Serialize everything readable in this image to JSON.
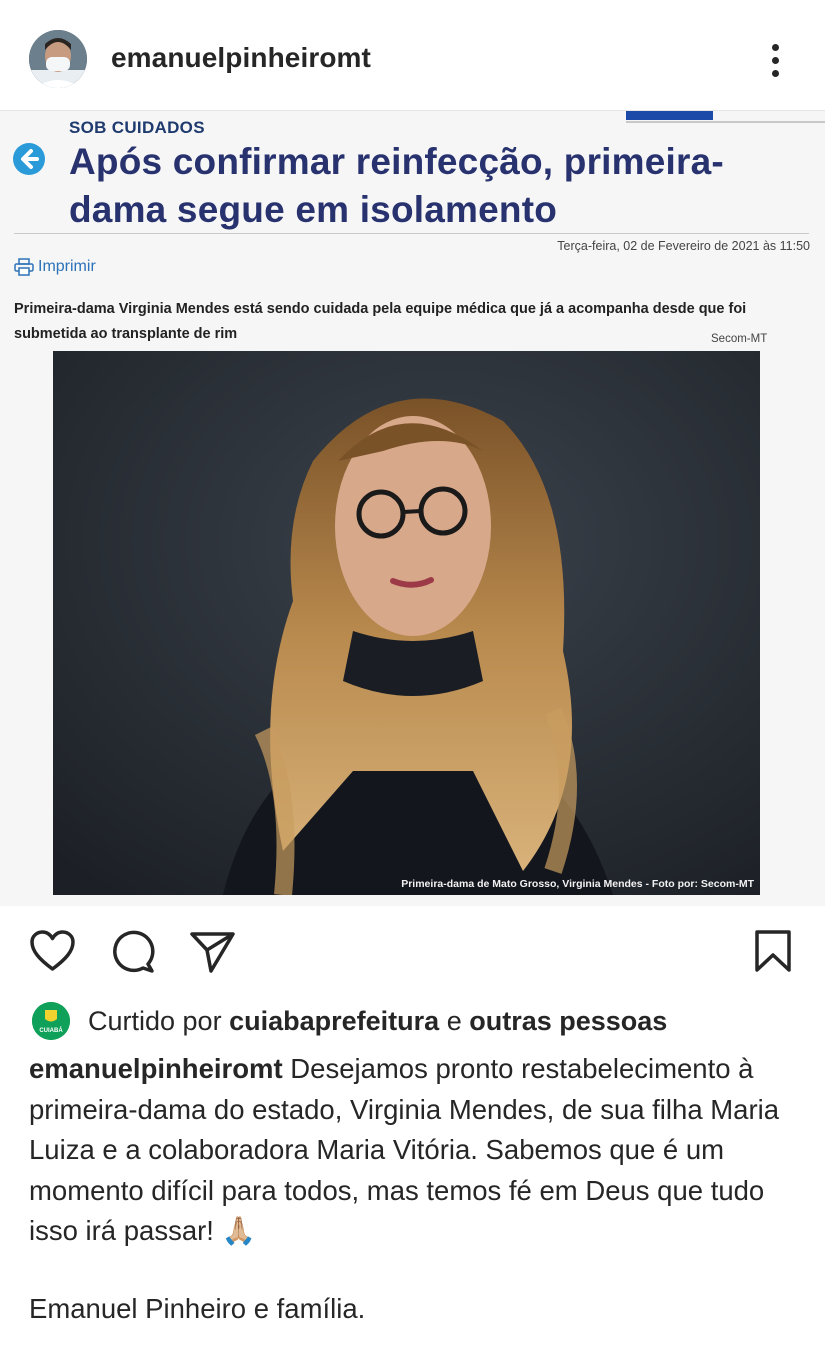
{
  "header": {
    "username": "emanuelpinheiromt"
  },
  "article": {
    "kicker": "SOB CUIDADOS",
    "headline": "Após confirmar reinfecção, primeira-dama segue em isolamento",
    "dateline": "Terça-feira, 02 de Fevereiro de 2021 às 11:50",
    "print_label": "Imprimir",
    "lead": "Primeira-dama Virginia Mendes está sendo cuidada pela equipe médica que já a acompanha desde que foi submetida ao transplante de rim",
    "credit": "Secom-MT",
    "photo_caption": "Primeira-dama de Mato Grosso, Virginia Mendes - Foto por: Secom-MT"
  },
  "actions": {
    "icons": [
      "heart-icon",
      "comment-icon",
      "share-icon",
      "bookmark-icon"
    ]
  },
  "likes": {
    "prefix": "Curtido por",
    "liker": "cuiabaprefeitura",
    "connector": "e",
    "others": "outras pessoas",
    "liker_avatar_text": "CUIABÁ"
  },
  "caption": {
    "author": "emanuelpinheiromt",
    "text": "Desejamos pronto restabelecimento à primeira-dama do estado, Virginia Mendes, de sua filha Maria Luiza e a colaboradora Maria Vitória. Sabemos que é um momento difícil para todos, mas temos fé em Deus que tudo isso irá passar! 🙏🏼",
    "signoff": "Emanuel Pinheiro e família."
  },
  "colors": {
    "headline": "#27326e",
    "link": "#2c72b8",
    "back_button": "#2a9ad8",
    "liker_avatar": "#0fa05a"
  }
}
